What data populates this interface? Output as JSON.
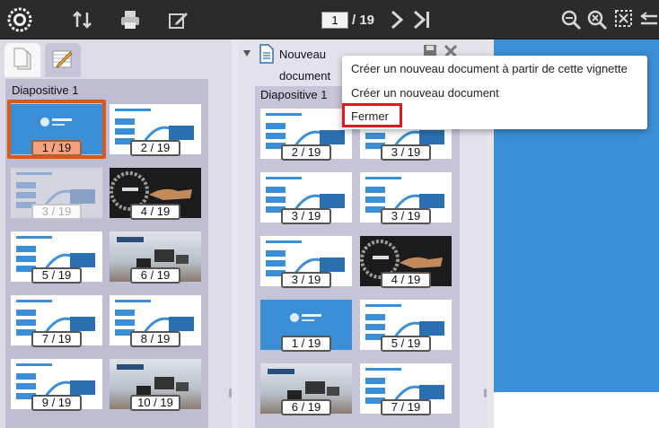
{
  "toolbar": {
    "icons": [
      "logo-icon",
      "sort-icon",
      "print-icon",
      "edit-icon",
      "chevron-right-icon",
      "last-page-icon",
      "zoom-out-icon",
      "zoom-reset-icon",
      "zoom-region-icon",
      "collapse-panel-icon"
    ],
    "current_page": "1",
    "total_pages": "/ 19"
  },
  "left_panel": {
    "tabs": [
      "document-tab-icon",
      "annotation-tab-icon"
    ],
    "group_title": "Diapositive 1",
    "thumbnails": [
      {
        "label": "1 / 19",
        "style": "s-blue",
        "selected": true
      },
      {
        "label": "2 / 19",
        "style": "s-white"
      },
      {
        "label": "3 / 19",
        "style": "s-white",
        "disabled": true
      },
      {
        "label": "4 / 19",
        "style": "s-dark"
      },
      {
        "label": "5 / 19",
        "style": "s-white"
      },
      {
        "label": "6 / 19",
        "style": "s-photo"
      },
      {
        "label": "7 / 19",
        "style": "s-white"
      },
      {
        "label": "8 / 19",
        "style": "s-white"
      },
      {
        "label": "9 / 19",
        "style": "s-white"
      },
      {
        "label": "10 / 19",
        "style": "s-photo"
      }
    ]
  },
  "right_panel": {
    "doc_title_line1": "Nouveau",
    "doc_title_line2": "document",
    "group_title": "Diapositive 1",
    "thumbnails": [
      {
        "label": "2 / 19",
        "style": "s-white"
      },
      {
        "label": "3 / 19",
        "style": "s-white"
      },
      {
        "label": "3 / 19",
        "style": "s-white"
      },
      {
        "label": "3 / 19",
        "style": "s-white"
      },
      {
        "label": "3 / 19",
        "style": "s-white"
      },
      {
        "label": "4 / 19",
        "style": "s-dark"
      },
      {
        "label": "1 / 19",
        "style": "s-blue"
      },
      {
        "label": "5 / 19",
        "style": "s-white"
      },
      {
        "label": "6 / 19",
        "style": "s-photo"
      },
      {
        "label": "7 / 19",
        "style": "s-white"
      }
    ]
  },
  "context_menu": {
    "items": [
      "Créer un nouveau document à partir de cette vignette",
      "Créer un nouveau document",
      "Fermer"
    ]
  },
  "colors": {
    "toolbar": "#2b2b2b",
    "selection": "#d85a1a",
    "current_badge": "#f4a37c",
    "highlight": "#e0191e",
    "viewer_slide": "#3a8fd6"
  }
}
